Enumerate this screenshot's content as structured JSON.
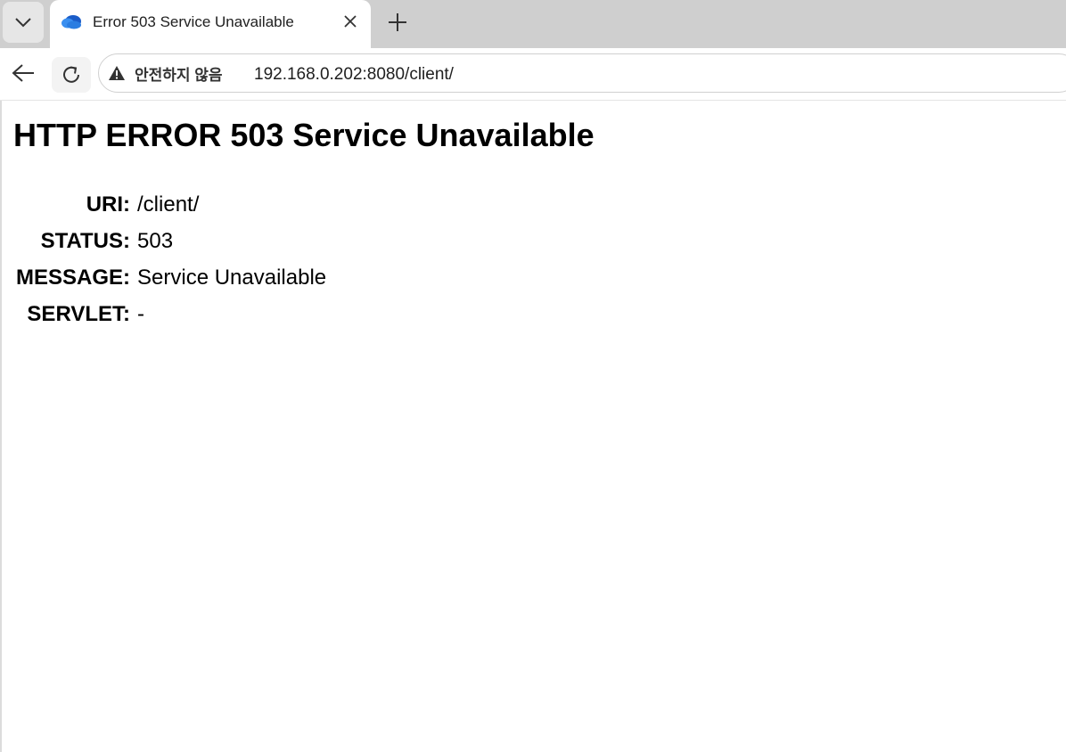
{
  "tab": {
    "title": "Error 503 Service Unavailable",
    "favicon_icon": "cloud-icon",
    "favicon_colors": [
      "#2a7de1",
      "#1a4fa0"
    ]
  },
  "toolbar": {
    "security_label": "안전하지 않음",
    "security_icon": "warning-triangle-icon",
    "url": "192.168.0.202:8080/client/"
  },
  "page": {
    "title": "HTTP ERROR 503 Service Unavailable",
    "rows": [
      {
        "label": "URI:",
        "value": "/client/"
      },
      {
        "label": "STATUS:",
        "value": "503"
      },
      {
        "label": "MESSAGE:",
        "value": "Service Unavailable"
      },
      {
        "label": "SERVLET:",
        "value": "-"
      }
    ]
  }
}
